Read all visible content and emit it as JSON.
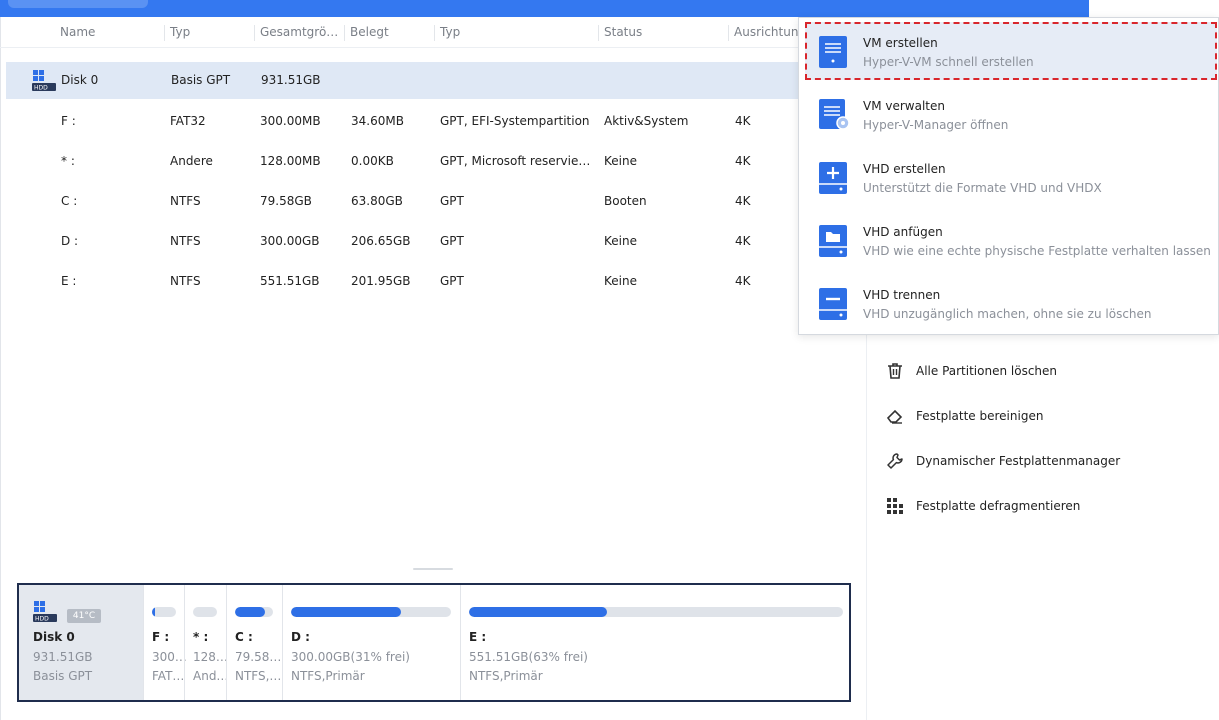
{
  "columns": [
    "Name",
    "Typ",
    "Gesamtgrö…",
    "Belegt",
    "Typ",
    "Status",
    "Ausrichtung"
  ],
  "disk_row": {
    "name": "Disk 0",
    "type": "Basis GPT",
    "size": "931.51GB"
  },
  "partitions": [
    {
      "name": "F :",
      "fs": "FAT32",
      "size": "300.00MB",
      "used": "34.60MB",
      "type": "GPT, EFI-Systempartition",
      "status": "Aktiv&System",
      "align": "4K"
    },
    {
      "name": "* :",
      "fs": "Andere",
      "size": "128.00MB",
      "used": "0.00KB",
      "type": "GPT, Microsoft reservie…",
      "status": "Keine",
      "align": "4K"
    },
    {
      "name": "C :",
      "fs": "NTFS",
      "size": "79.58GB",
      "used": "63.80GB",
      "type": "GPT",
      "status": "Booten",
      "align": "4K"
    },
    {
      "name": "D :",
      "fs": "NTFS",
      "size": "300.00GB",
      "used": "206.65GB",
      "type": "GPT",
      "status": "Keine",
      "align": "4K"
    },
    {
      "name": "E :",
      "fs": "NTFS",
      "size": "551.51GB",
      "used": "201.95GB",
      "type": "GPT",
      "status": "Keine",
      "align": "4K"
    }
  ],
  "menu": [
    {
      "title": "VM erstellen",
      "subtitle": "Hyper-V-VM schnell erstellen",
      "icon": "vm-create-icon"
    },
    {
      "title": "VM verwalten",
      "subtitle": "Hyper-V-Manager öffnen",
      "icon": "vm-manage-icon"
    },
    {
      "title": "VHD erstellen",
      "subtitle": "Unterstützt die Formate VHD und VHDX",
      "icon": "vhd-create-icon"
    },
    {
      "title": "VHD anfügen",
      "subtitle": "VHD wie eine echte physische Festplatte verhalten lassen",
      "icon": "vhd-attach-icon"
    },
    {
      "title": "VHD trennen",
      "subtitle": "VHD unzugänglich machen, ohne sie zu löschen",
      "icon": "vhd-detach-icon"
    }
  ],
  "actions": [
    {
      "label": "Alle Partitionen löschen",
      "icon": "trash-icon"
    },
    {
      "label": "Festplatte bereinigen",
      "icon": "eraser-icon"
    },
    {
      "label": "Dynamischer Festplattenmanager",
      "icon": "wrench-icon"
    },
    {
      "label": "Festplatte defragmentieren",
      "icon": "defrag-icon"
    }
  ],
  "diskmap": {
    "disk": {
      "name": "Disk 0",
      "size": "931.51GB",
      "type": "Basis GPT",
      "temp": "41°C",
      "badge": "HDD"
    },
    "segments": [
      {
        "label": "F :",
        "line1": "300…",
        "line2": "FAT…",
        "used_fraction": 0.12
      },
      {
        "label": "* :",
        "line1": "128…",
        "line2": "And…",
        "used_fraction": 0.0
      },
      {
        "label": "C :",
        "line1": "79.58…",
        "line2": "NTFS,…",
        "used_fraction": 0.8
      },
      {
        "label": "D :",
        "line1": "300.00GB(31% frei)",
        "line2": "NTFS,Primär",
        "used_fraction": 0.69
      },
      {
        "label": "E :",
        "line1": "551.51GB(63% frei)",
        "line2": "NTFS,Primär",
        "used_fraction": 0.37
      }
    ]
  },
  "colors": {
    "accent": "#3478f0",
    "bar_fill": "#2e6fe6",
    "selection": "#dfe8f5",
    "highlight_border": "#d9262c"
  }
}
